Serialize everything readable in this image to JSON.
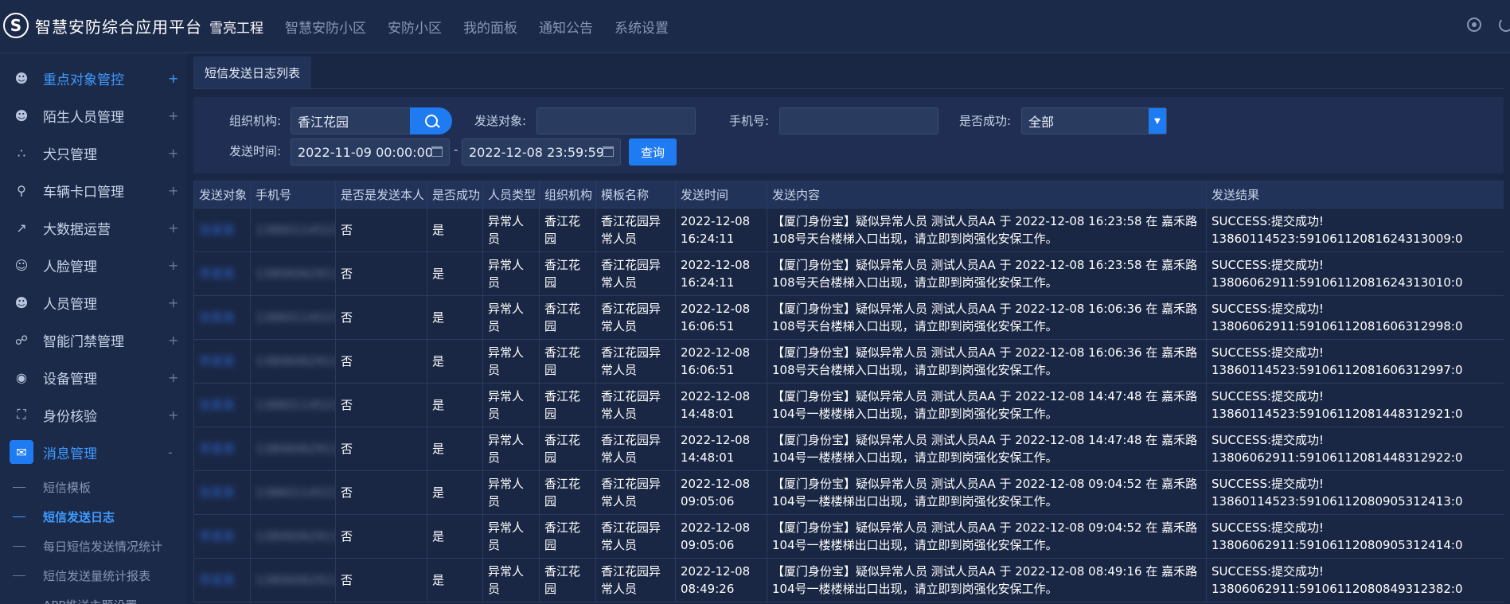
{
  "app": {
    "title": "智慧安防综合应用平台",
    "logo": "S"
  },
  "topnav": [
    "雪亮工程",
    "智慧安防小区",
    "安防小区",
    "我的面板",
    "通知公告",
    "系统设置"
  ],
  "sidebar": {
    "items": [
      {
        "label": "重点对象管控",
        "icon": "user-icon",
        "toggle": "+"
      },
      {
        "label": "陌生人员管理",
        "icon": "user-icon",
        "toggle": "+"
      },
      {
        "label": "犬只管理",
        "icon": "network-icon",
        "toggle": "+"
      },
      {
        "label": "车辆卡口管理",
        "icon": "barrier-icon",
        "toggle": "+"
      },
      {
        "label": "大数据运营",
        "icon": "trend-icon",
        "toggle": "+"
      },
      {
        "label": "人脸管理",
        "icon": "smile-icon",
        "toggle": "+"
      },
      {
        "label": "人员管理",
        "icon": "user-icon",
        "toggle": "+"
      },
      {
        "label": "智能门禁管理",
        "icon": "lock-icon",
        "toggle": "+"
      },
      {
        "label": "设备管理",
        "icon": "camera-icon",
        "toggle": "+"
      },
      {
        "label": "身份核验",
        "icon": "scan-icon",
        "toggle": "+"
      },
      {
        "label": "消息管理",
        "icon": "chat-icon",
        "toggle": "-"
      }
    ],
    "subitems": [
      "短信模板",
      "短信发送日志",
      "每日短信发送情况统计",
      "短信发送量统计报表",
      "APP推送主题设置"
    ]
  },
  "tab": {
    "label": "短信发送日志列表"
  },
  "filter": {
    "org_label": "组织机构:",
    "org_value": "香江花园",
    "target_label": "发送对象:",
    "target_value": "",
    "phone_label": "手机号:",
    "phone_value": "",
    "success_label": "是否成功:",
    "success_value": "全部",
    "time_label": "发送时间:",
    "time_start": "2022-11-09 00:00:00",
    "time_sep": "-",
    "time_end": "2022-12-08 23:59:59",
    "query_label": "查询"
  },
  "table": {
    "headers": [
      "发送对象",
      "手机号",
      "是否是发送本人",
      "是否成功",
      "人员类型",
      "组织机构",
      "模板名称",
      "发送时间",
      "发送内容",
      "发送结果"
    ],
    "rows": [
      {
        "target": "张某某",
        "phone": "13860114523",
        "self": "否",
        "success": "是",
        "type": "异常人员",
        "org": "香江花园",
        "template": "香江花园异常人员",
        "time1": "2022-12-08",
        "time2": "16:24:11",
        "content": "【厦门身份宝】疑似异常人员 测试人员AA 于 2022-12-08 16:23:58 在 嘉禾路108号天台楼梯入口出现，请立即到岗强化安保工作。",
        "result1": "SUCCESS:提交成功!",
        "result2": "13860114523:5910611208162431300​9:0"
      },
      {
        "target": "李某某",
        "phone": "13806062911",
        "self": "否",
        "success": "是",
        "type": "异常人员",
        "org": "香江花园",
        "template": "香江花园异常人员",
        "time1": "2022-12-08",
        "time2": "16:24:11",
        "content": "【厦门身份宝】疑似异常人员 测试人员AA 于 2022-12-08 16:23:58 在 嘉禾路108号天台楼梯入口出现，请立即到岗强化安保工作。",
        "result1": "SUCCESS:提交成功!",
        "result2": "13806062911:5910611208162431301​0:0"
      },
      {
        "target": "张某某",
        "phone": "13860114523",
        "self": "否",
        "success": "是",
        "type": "异常人员",
        "org": "香江花园",
        "template": "香江花园异常人员",
        "time1": "2022-12-08",
        "time2": "16:06:51",
        "content": "【厦门身份宝】疑似异常人员 测试人员AA 于 2022-12-08 16:06:36 在 嘉禾路108号天台楼梯入口出现，请立即到岗强化安保工作。",
        "result1": "SUCCESS:提交成功!",
        "result2": "13806062911:5910611208160631299​8:0"
      },
      {
        "target": "李某某",
        "phone": "13806062911",
        "self": "否",
        "success": "是",
        "type": "异常人员",
        "org": "香江花园",
        "template": "香江花园异常人员",
        "time1": "2022-12-08",
        "time2": "16:06:51",
        "content": "【厦门身份宝】疑似异常人员 测试人员AA 于 2022-12-08 16:06:36 在 嘉禾路108号天台楼梯入口出现，请立即到岗强化安保工作。",
        "result1": "SUCCESS:提交成功!",
        "result2": "13860114523:5910611208160631299​7:0"
      },
      {
        "target": "张某某",
        "phone": "13860114523",
        "self": "否",
        "success": "是",
        "type": "异常人员",
        "org": "香江花园",
        "template": "香江花园异常人员",
        "time1": "2022-12-08",
        "time2": "14:48:01",
        "content": "【厦门身份宝】疑似异常人员 测试人员AA 于 2022-12-08 14:47:48 在 嘉禾路104号一楼楼梯入口出现，请立即到岗强化安保工作。",
        "result1": "SUCCESS:提交成功!",
        "result2": "13860114523:5910611208144831292​1:0"
      },
      {
        "target": "李某某",
        "phone": "13806062911",
        "self": "否",
        "success": "是",
        "type": "异常人员",
        "org": "香江花园",
        "template": "香江花园异常人员",
        "time1": "2022-12-08",
        "time2": "14:48:01",
        "content": "【厦门身份宝】疑似异常人员 测试人员AA 于 2022-12-08 14:47:48 在 嘉禾路104号一楼楼梯入口出现，请立即到岗强化安保工作。",
        "result1": "SUCCESS:提交成功!",
        "result2": "13806062911:5910611208144831292​2:0"
      },
      {
        "target": "张某某",
        "phone": "13860114523",
        "self": "否",
        "success": "是",
        "type": "异常人员",
        "org": "香江花园",
        "template": "香江花园异常人员",
        "time1": "2022-12-08",
        "time2": "09:05:06",
        "content": "【厦门身份宝】疑似异常人员 测试人员AA 于 2022-12-08 09:04:52 在 嘉禾路104号一楼楼梯出口出现，请立即到岗强化安保工作。",
        "result1": "SUCCESS:提交成功!",
        "result2": "13860114523:5910611208090531241​3:0"
      },
      {
        "target": "李某某",
        "phone": "13806062911",
        "self": "否",
        "success": "是",
        "type": "异常人员",
        "org": "香江花园",
        "template": "香江花园异常人员",
        "time1": "2022-12-08",
        "time2": "09:05:06",
        "content": "【厦门身份宝】疑似异常人员 测试人员AA 于 2022-12-08 09:04:52 在 嘉禾路104号一楼楼梯出口出现，请立即到岗强化安保工作。",
        "result1": "SUCCESS:提交成功!",
        "result2": "13806062911:5910611208090531241​4:0"
      },
      {
        "target": "李某某",
        "phone": "13806062911",
        "self": "否",
        "success": "是",
        "type": "异常人员",
        "org": "香江花园",
        "template": "香江花园异常人员",
        "time1": "2022-12-08",
        "time2": "08:49:26",
        "content": "【厦门身份宝】疑似异常人员 测试人员AA 于 2022-12-08 08:49:16 在 嘉禾路104号一楼楼梯出口出现，请立即到岗强化安保工作。",
        "result1": "SUCCESS:提交成功!",
        "result2": "13806062911:5910611208084931238​2:0"
      }
    ]
  },
  "colors": {
    "accent": "#1e7bf2",
    "active_text": "#3d9bff",
    "bg": "#1a2744"
  }
}
